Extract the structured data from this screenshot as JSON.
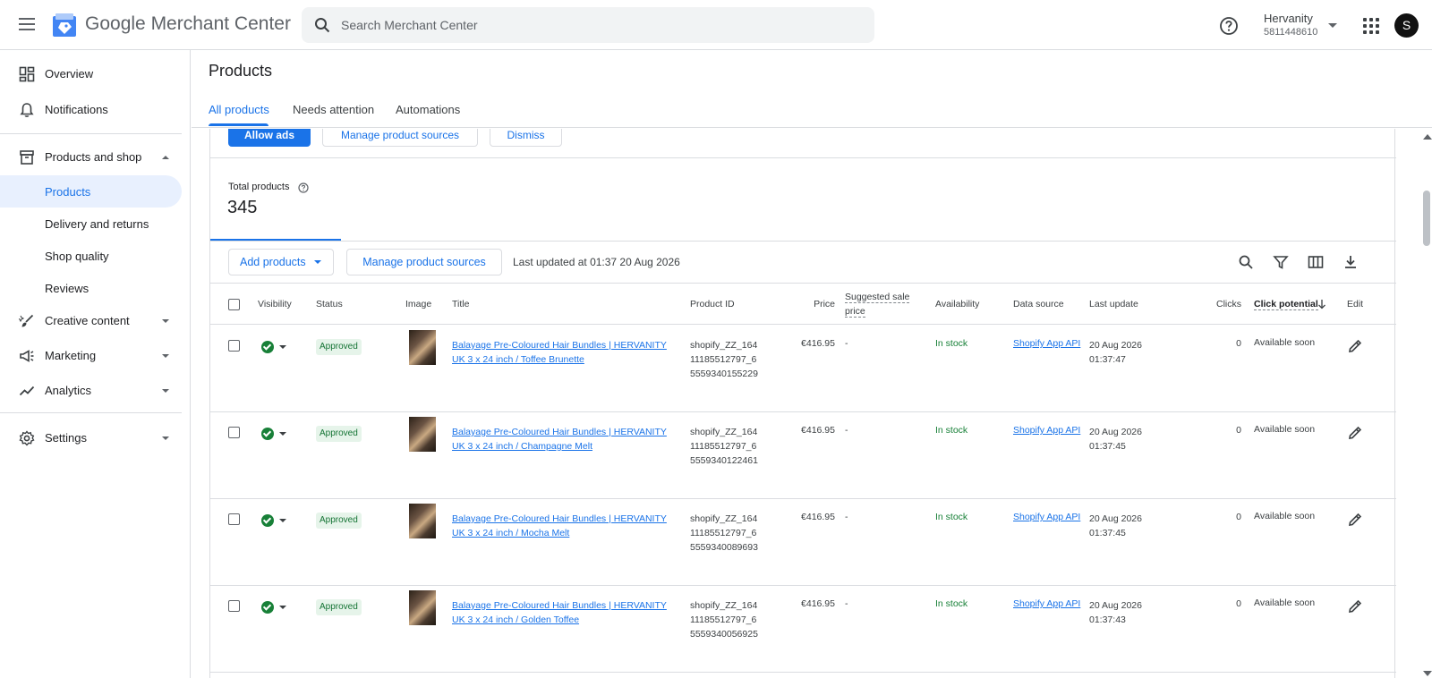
{
  "header": {
    "logo_google": "Google",
    "logo_product": "Merchant Center",
    "search_placeholder": "Search Merchant Center",
    "account_name": "Hervanity",
    "account_id": "5811448610",
    "avatar_letter": "S"
  },
  "sidebar": {
    "items": [
      {
        "label": "Overview",
        "icon": "dashboard-icon"
      },
      {
        "label": "Notifications",
        "icon": "bell-icon"
      },
      {
        "label": "Products and shop",
        "icon": "store-icon"
      },
      {
        "label": "Creative content",
        "icon": "brush-icon"
      },
      {
        "label": "Marketing",
        "icon": "megaphone-icon"
      },
      {
        "label": "Analytics",
        "icon": "trending-icon"
      },
      {
        "label": "Settings",
        "icon": "gear-icon"
      }
    ],
    "sub_items": [
      {
        "label": "Products",
        "active": true
      },
      {
        "label": "Delivery and returns",
        "active": false
      },
      {
        "label": "Shop quality",
        "active": false
      },
      {
        "label": "Reviews",
        "active": false
      }
    ]
  },
  "page": {
    "title": "Products",
    "tabs": [
      "All products",
      "Needs attention",
      "Automations"
    ],
    "active_tab": "All products"
  },
  "banner": {
    "allow_ads": "Allow ads",
    "manage_sources": "Manage product sources",
    "dismiss": "Dismiss"
  },
  "summary": {
    "total_label": "Total products",
    "total_value": "345"
  },
  "toolbar": {
    "add_products": "Add products",
    "manage_sources": "Manage product sources",
    "last_updated": "Last updated at 01:37 20 Aug 2026"
  },
  "table": {
    "columns": {
      "visibility": "Visibility",
      "status": "Status",
      "image": "Image",
      "title": "Title",
      "product_id": "Product ID",
      "price": "Price",
      "sale_price": "Suggested sale price",
      "availability": "Availability",
      "data_source": "Data source",
      "last_update": "Last update",
      "clicks": "Clicks",
      "click_potential": "Click potential",
      "edit": "Edit"
    },
    "rows": [
      {
        "status": "Approved",
        "title": "Balayage Pre-Coloured Hair Bundles | HERVANITY UK 3 x 24 inch / Toffee Brunette",
        "product_id": "shopify_ZZ_16411185512797_65559340155229",
        "price": "€416.95",
        "sale_price": "-",
        "availability": "In stock",
        "data_source": "Shopify App API",
        "last_update": "20 Aug 2026 01:37:47",
        "clicks": "0",
        "click_potential": "Available soon"
      },
      {
        "status": "Approved",
        "title": "Balayage Pre-Coloured Hair Bundles | HERVANITY UK 3 x 24 inch / Champagne Melt",
        "product_id": "shopify_ZZ_16411185512797_65559340122461",
        "price": "€416.95",
        "sale_price": "-",
        "availability": "In stock",
        "data_source": "Shopify App API",
        "last_update": "20 Aug 2026 01:37:45",
        "clicks": "0",
        "click_potential": "Available soon"
      },
      {
        "status": "Approved",
        "title": "Balayage Pre-Coloured Hair Bundles | HERVANITY UK 3 x 24 inch / Mocha Melt",
        "product_id": "shopify_ZZ_16411185512797_65559340089693",
        "price": "€416.95",
        "sale_price": "-",
        "availability": "In stock",
        "data_source": "Shopify App API",
        "last_update": "20 Aug 2026 01:37:45",
        "clicks": "0",
        "click_potential": "Available soon"
      },
      {
        "status": "Approved",
        "title": "Balayage Pre-Coloured Hair Bundles | HERVANITY UK 3 x 24 inch / Golden Toffee",
        "product_id": "shopify_ZZ_16411185512797_65559340056925",
        "price": "€416.95",
        "sale_price": "-",
        "availability": "In stock",
        "data_source": "Shopify App API",
        "last_update": "20 Aug 2026 01:37:43",
        "clicks": "0",
        "click_potential": "Available soon"
      }
    ]
  },
  "colors": {
    "accent": "#1a73e8",
    "success": "#188038",
    "approved_bg": "#e6f4ea"
  }
}
